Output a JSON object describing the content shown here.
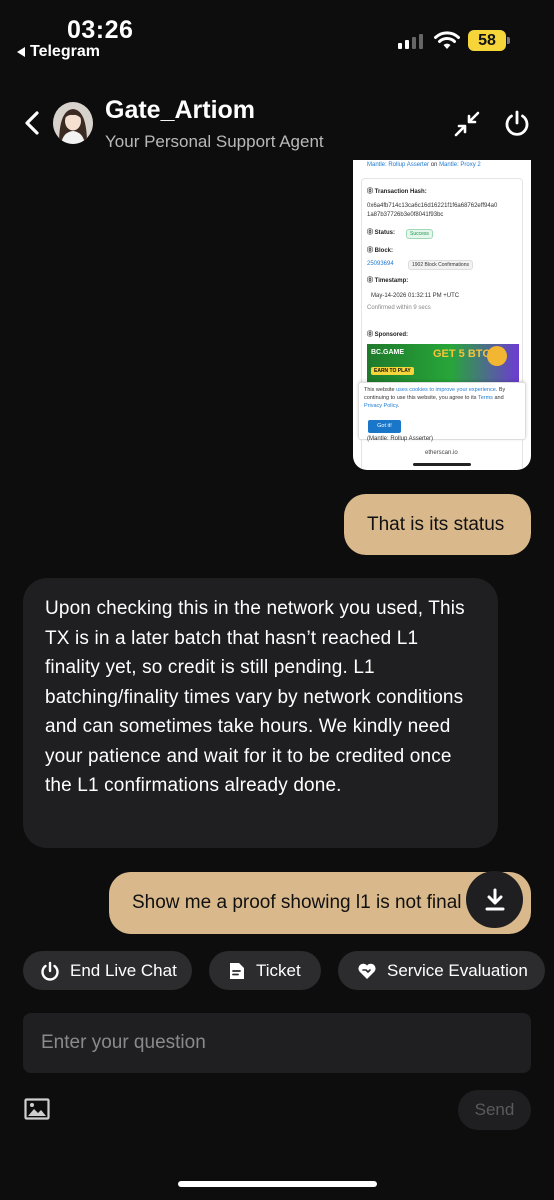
{
  "status_bar": {
    "time": "03:26",
    "back_app": "Telegram",
    "battery": "58"
  },
  "header": {
    "agent_name": "Gate_Artiom",
    "agent_subtitle": "Your Personal Support Agent"
  },
  "attachment": {
    "top_line_prefix": "Mantle: Rollup Asserter",
    "top_line_on": "on",
    "top_line_suffix": "Mantle: Proxy 2",
    "tx_hash_label": "Transaction Hash:",
    "tx_hash_line1": "0x6a4fb714c13ca6c16d16221f1f6a68762eff94a0",
    "tx_hash_line2": "1a87b37726b3e0f8041f93bc",
    "status_label": "Status:",
    "status_value": "Success",
    "block_label": "Block:",
    "block_number": "25093694",
    "block_confirmations": "1902 Block Confirmations",
    "timestamp_label": "Timestamp:",
    "timestamp_value": "May-14-2026 01:32:11 PM +UTC",
    "timestamp_note": "Confirmed within 9 secs",
    "sponsored_label": "Sponsored:",
    "ad_brand": "BC.GAME",
    "ad_cta": "EARN TO PLAY",
    "ad_text": "GET 5 BTC",
    "cookie_p1": "This website",
    "cookie_link1": "uses cookies to improve your experience",
    "cookie_p2": ". By continuing to use this website, you agree to its",
    "cookie_terms": "Terms",
    "cookie_and": "and",
    "cookie_privacy": "Privacy Policy",
    "cookie_button": "Got it!",
    "bottom_line": "(Mantle: Rollup Asserter)",
    "domain": "etherscan.io"
  },
  "messages": {
    "msg1": "That is its status",
    "msg2": "Upon checking this in the network you used, This TX is in a later batch that hasn’t reached L1 finality yet, so credit is still pending. L1 batching/finality times vary by network conditions and can sometimes take hours. We kindly need your patience and wait for it to be credited once the L1 confirmations already done.",
    "msg3": "Show me a proof showing l1 is not final"
  },
  "actions": {
    "end_live_chat": "End Live Chat",
    "ticket": "Ticket",
    "service_evaluation": "Service Evaluation"
  },
  "composer": {
    "placeholder": "Enter your question",
    "send": "Send"
  },
  "colors": {
    "background": "#0d0d0d",
    "outgoing_bubble": "#d9b98b",
    "incoming_bubble": "#1f1f21",
    "chip": "#2c2c2f",
    "battery": "#f5d53a"
  }
}
